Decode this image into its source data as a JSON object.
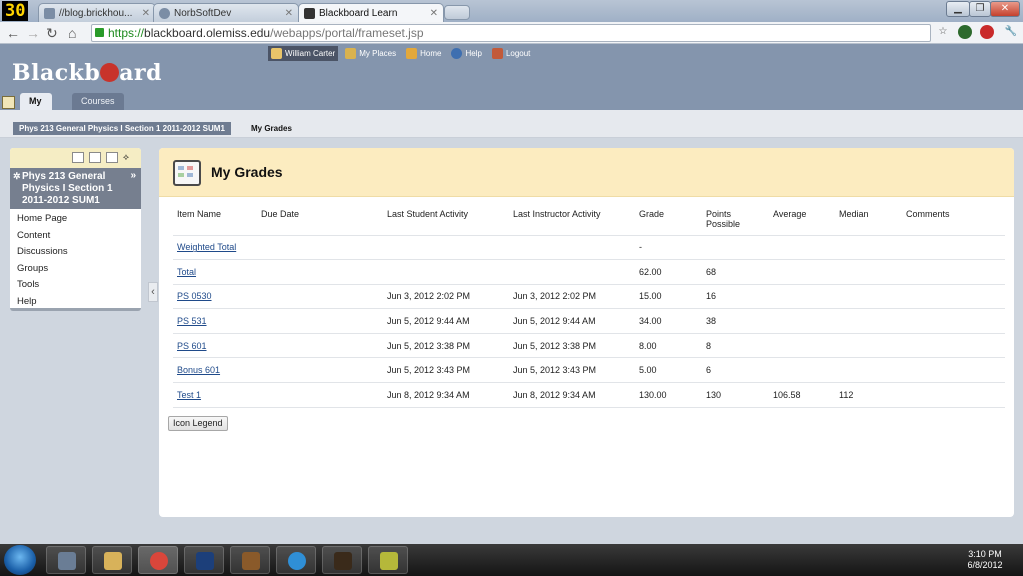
{
  "browser": {
    "fps_counter": "30",
    "tabs": [
      {
        "label": "//blog.brickhou..."
      },
      {
        "label": "NorbSoftDev"
      },
      {
        "label": "Blackboard Learn"
      }
    ],
    "url_scheme": "https://",
    "url_host": "blackboard.olemiss.edu",
    "url_path": "/webapps/portal/frameset.jsp"
  },
  "header": {
    "logo_left": "Blackb",
    "logo_right": "ard",
    "top_menu": [
      {
        "label": "William Carter"
      },
      {
        "label": "My Places"
      },
      {
        "label": "Home"
      },
      {
        "label": "Help"
      },
      {
        "label": "Logout"
      }
    ],
    "tabs": [
      {
        "label": "My UM"
      },
      {
        "label": "Courses"
      }
    ]
  },
  "breadcrumb": {
    "course": "Phys 213 General Physics I Section 1 2011-2012 SUM1",
    "page": "My Grades"
  },
  "course_menu": {
    "title": "Phys 213 General Physics I Section 1 2011-2012 SUM1",
    "items": [
      {
        "label": "Home Page"
      },
      {
        "label": "Content"
      },
      {
        "label": "Discussions"
      },
      {
        "label": "Groups"
      },
      {
        "label": "Tools"
      },
      {
        "label": "Help"
      }
    ]
  },
  "content": {
    "title": "My Grades",
    "columns": {
      "item_name": "Item Name",
      "due_date": "Due Date",
      "last_student": "Last Student Activity",
      "last_instructor": "Last Instructor Activity",
      "grade": "Grade",
      "points": "Points Possible",
      "average": "Average",
      "median": "Median",
      "comments": "Comments"
    },
    "rows": [
      {
        "name": "Weighted Total",
        "due": "",
        "student": "",
        "instructor": "",
        "grade": "-",
        "points": "",
        "average": "",
        "median": "",
        "comments": ""
      },
      {
        "name": "Total",
        "due": "",
        "student": "",
        "instructor": "",
        "grade": "62.00",
        "points": "68",
        "average": "",
        "median": "",
        "comments": ""
      },
      {
        "name": "PS 0530",
        "due": "",
        "student": "Jun 3, 2012 2:02 PM",
        "instructor": "Jun 3, 2012 2:02 PM",
        "grade": "15.00",
        "points": "16",
        "average": "",
        "median": "",
        "comments": ""
      },
      {
        "name": "PS 531",
        "due": "",
        "student": "Jun 5, 2012 9:44 AM",
        "instructor": "Jun 5, 2012 9:44 AM",
        "grade": "34.00",
        "points": "38",
        "average": "",
        "median": "",
        "comments": ""
      },
      {
        "name": "PS 601",
        "due": "",
        "student": "Jun 5, 2012 3:38 PM",
        "instructor": "Jun 5, 2012 3:38 PM",
        "grade": "8.00",
        "points": "8",
        "average": "",
        "median": "",
        "comments": ""
      },
      {
        "name": "Bonus 601",
        "due": "",
        "student": "Jun 5, 2012 3:43 PM",
        "instructor": "Jun 5, 2012 3:43 PM",
        "grade": "5.00",
        "points": "6",
        "average": "",
        "median": "",
        "comments": ""
      },
      {
        "name": "Test 1",
        "due": "",
        "student": "Jun 8, 2012 9:34 AM",
        "instructor": "Jun 8, 2012 9:34 AM",
        "grade": "130.00",
        "points": "130",
        "average": "106.58",
        "median": "112",
        "comments": ""
      }
    ],
    "legend_button": "Icon Legend"
  },
  "taskbar": {
    "time": "3:10 PM",
    "date": "6/8/2012"
  },
  "colors": {
    "header_bg": "#8495ad",
    "content_head_bg": "#fcecc0",
    "link": "#1f4a8a",
    "logo_accent": "#c8332b"
  }
}
